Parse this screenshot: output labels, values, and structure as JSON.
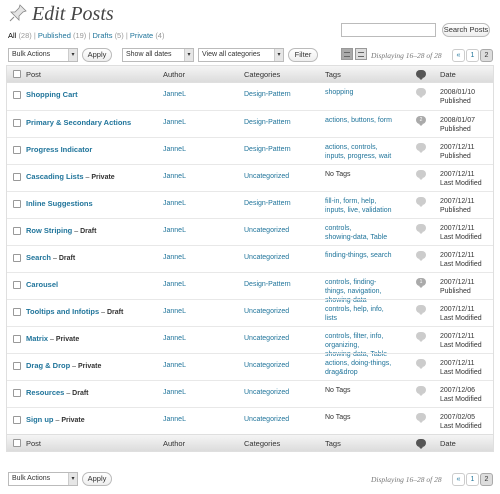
{
  "header": {
    "title": "Edit Posts"
  },
  "filters": {
    "all": "All",
    "all_count": "(28)",
    "published": "Published",
    "published_count": "(19)",
    "drafts": "Drafts",
    "drafts_count": "(5)",
    "private": "Private",
    "private_count": "(4)",
    "sep": "|"
  },
  "search": {
    "button": "Search Posts",
    "value": ""
  },
  "toolbar": {
    "bulk_actions": "Bulk Actions",
    "apply": "Apply",
    "dates": "Show all dates",
    "categories": "View all categories",
    "filter": "Filter",
    "displaying": "Displaying 16–28 of 28",
    "pages": [
      "«",
      "1",
      "2"
    ],
    "current_page": "2"
  },
  "columns": {
    "post": "Post",
    "author": "Author",
    "categories": "Categories",
    "tags": "Tags",
    "date": "Date"
  },
  "rows": [
    {
      "title": "Shopping Cart",
      "state": "",
      "author": "JanneL",
      "category": "Design-Pattern",
      "tags": [
        "shopping"
      ],
      "date": "2008/01/10",
      "status": "Published",
      "comment_count": ""
    },
    {
      "title": "Primary & Secondary Actions",
      "state": "",
      "author": "JanneL",
      "category": "Design-Pattern",
      "tags": [
        "actions, buttons, form"
      ],
      "date": "2008/01/07",
      "status": "Published",
      "comment_count": "2"
    },
    {
      "title": "Progress Indicator",
      "state": "",
      "author": "JanneL",
      "category": "Design-Pattern",
      "tags": [
        "actions, controls,",
        "inputs, progress, wait"
      ],
      "date": "2007/12/11",
      "status": "Published",
      "comment_count": ""
    },
    {
      "title": "Cascading Lists",
      "state": "Private",
      "author": "JanneL",
      "category": "Uncategorized",
      "tags": [
        "No Tags"
      ],
      "date": "2007/12/11",
      "status": "Last Modified",
      "comment_count": ""
    },
    {
      "title": "Inline Suggestions",
      "state": "",
      "author": "JanneL",
      "category": "Design-Pattern",
      "tags": [
        "fill-in, form, help,",
        "inputs, live, validation"
      ],
      "date": "2007/12/11",
      "status": "Published",
      "comment_count": ""
    },
    {
      "title": "Row Striping",
      "state": "Draft",
      "author": "JanneL",
      "category": "Uncategorized",
      "tags": [
        "controls,",
        "showing-data, Table"
      ],
      "date": "2007/12/11",
      "status": "Last Modified",
      "comment_count": ""
    },
    {
      "title": "Search",
      "state": "Draft",
      "author": "JanneL",
      "category": "Uncategorized",
      "tags": [
        "finding-things, search"
      ],
      "date": "2007/12/11",
      "status": "Last Modified",
      "comment_count": ""
    },
    {
      "title": "Carousel",
      "state": "",
      "author": "JanneL",
      "category": "Design-Pattern",
      "tags": [
        "controls, finding-",
        "things, navigation,",
        "showing-data"
      ],
      "date": "2007/12/11",
      "status": "Published",
      "comment_count": "1"
    },
    {
      "title": "Tooltips and Infotips",
      "state": "Draft",
      "author": "JanneL",
      "category": "Uncategorized",
      "tags": [
        "controls, help, info,",
        "lists"
      ],
      "date": "2007/12/11",
      "status": "Last Modified",
      "comment_count": ""
    },
    {
      "title": "Matrix",
      "state": "Private",
      "author": "JanneL",
      "category": "Uncategorized",
      "tags": [
        "controls, filter, info,",
        "organizing,",
        "showing-data, Table"
      ],
      "date": "2007/12/11",
      "status": "Last Modified",
      "comment_count": ""
    },
    {
      "title": "Drag & Drop",
      "state": "Private",
      "author": "JanneL",
      "category": "Uncategorized",
      "tags": [
        "actions, doing-things,",
        "drag&drop"
      ],
      "date": "2007/12/11",
      "status": "Last Modified",
      "comment_count": ""
    },
    {
      "title": "Resources",
      "state": "Draft",
      "author": "JanneL",
      "category": "Uncategorized",
      "tags": [
        "No Tags"
      ],
      "date": "2007/12/06",
      "status": "Last Modified",
      "comment_count": ""
    },
    {
      "title": "Sign up",
      "state": "Private",
      "author": "JanneL",
      "category": "Uncategorized",
      "tags": [
        "No Tags"
      ],
      "date": "2007/02/05",
      "status": "Last Modified",
      "comment_count": ""
    }
  ],
  "icons": {
    "title": "pushpin-icon",
    "comments": "speech-bubble-icon",
    "views": [
      "list-view-icon",
      "excerpt-view-icon"
    ]
  }
}
